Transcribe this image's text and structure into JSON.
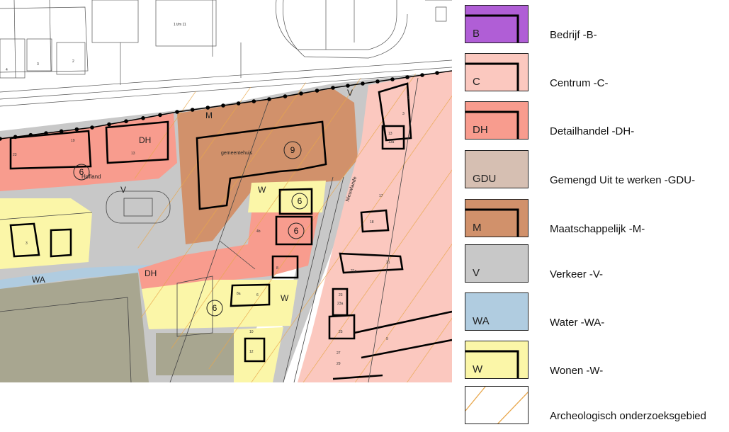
{
  "map": {
    "zone_labels": {
      "m": "M",
      "v_top": "V",
      "dh_top": "DH",
      "v_mid": "V",
      "w_mid": "W",
      "dh_low": "DH",
      "w_low": "W",
      "wa": "WA"
    },
    "street_labels": {
      "hofland": "Hofland",
      "nieuwlande": "Nieuwlande"
    },
    "building_labels": {
      "gemeentehuis": "gemeentehuis",
      "t_m_11": "1 t/m 11"
    },
    "height_markers": [
      "9",
      "6",
      "6",
      "6",
      "6"
    ],
    "house_numbers": [
      "4",
      "3",
      "2",
      "23",
      "19",
      "13",
      "3",
      "4b",
      "8",
      "8a",
      "6",
      "10",
      "12",
      "1",
      "3",
      "13",
      "13a",
      "17",
      "18",
      "21a",
      "21",
      "23",
      "23a",
      "25",
      "27",
      "29",
      "9"
    ]
  },
  "legend": {
    "items": [
      {
        "code": "B",
        "label": "Bedrijf -B-",
        "color": "#b05ed6",
        "corner": true
      },
      {
        "code": "C",
        "label": "Centrum -C-",
        "color": "#fbc8bf",
        "corner": true
      },
      {
        "code": "DH",
        "label": "Detailhandel -DH-",
        "color": "#f89c8e",
        "corner": true
      },
      {
        "code": "GDU",
        "label": "Gemengd Uit te werken -GDU-",
        "color": "#d6bfb2",
        "corner": false
      },
      {
        "code": "M",
        "label": "Maatschappelijk -M-",
        "color": "#d1916b",
        "corner": true
      },
      {
        "code": "V",
        "label": "Verkeer -V-",
        "color": "#c8c8c8",
        "corner": false
      },
      {
        "code": "WA",
        "label": "Water -WA-",
        "color": "#b0cce0",
        "corner": false
      },
      {
        "code": "W",
        "label": "Wonen -W-",
        "color": "#fbf6a8",
        "corner": true
      },
      {
        "code": "",
        "label": "Archeologisch onderzoeksgebied",
        "color": "#ffffff",
        "corner": false,
        "hatch": true
      }
    ]
  },
  "colors": {
    "bedrijf": "#b05ed6",
    "centrum": "#fbc8bf",
    "detailhandel": "#f89c8e",
    "gemengd": "#d6bfb2",
    "maatschappelijk": "#d1916b",
    "verkeer": "#c8c8c8",
    "water": "#b0cce0",
    "wonen": "#fbf6a8",
    "sport": "#a8a690",
    "hatch": "#e8a64a"
  }
}
